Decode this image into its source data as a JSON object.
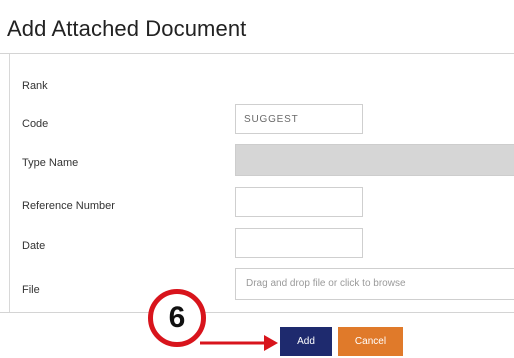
{
  "dialog": {
    "title": "Add Attached Document"
  },
  "form": {
    "rank_label": "Rank",
    "code_label": "Code",
    "code_value": "SUGGEST",
    "type_name_label": "Type Name",
    "type_name_value": "",
    "reference_number_label": "Reference Number",
    "reference_number_value": "",
    "date_label": "Date",
    "date_value": "",
    "file_label": "File",
    "file_dropzone_text": "Drag and drop file or click to browse"
  },
  "buttons": {
    "add_label": "Add",
    "cancel_label": "Cancel",
    "add_color": "#1e2a6e",
    "cancel_color": "#e07a2a"
  },
  "annotation": {
    "step_number": "6",
    "callout_color": "#d8141c"
  }
}
